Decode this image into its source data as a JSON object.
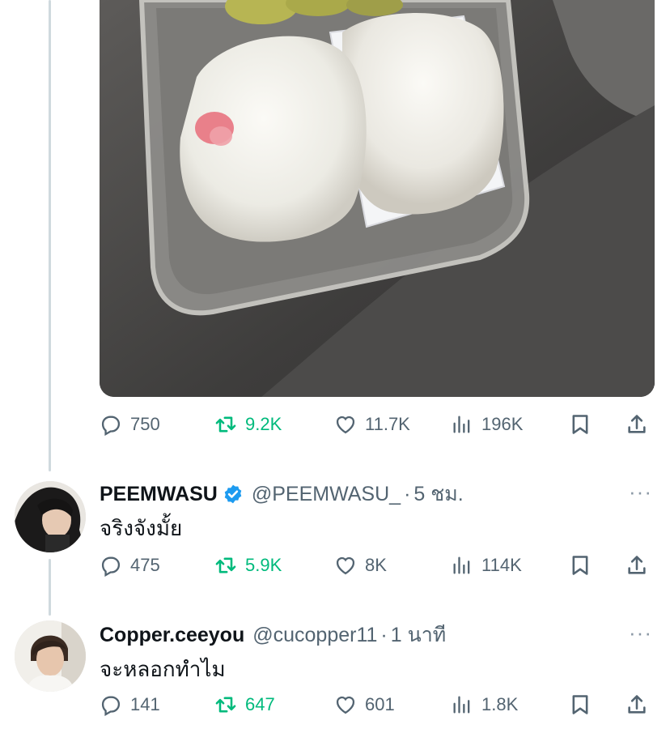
{
  "tweet1": {
    "stats": {
      "replies": "750",
      "retweets": "9.2K",
      "likes": "11.7K",
      "views": "196K"
    }
  },
  "tweet2": {
    "name": "PEEMWASU",
    "verified": true,
    "handle": "@PEEMWASU_",
    "separator": "·",
    "time": "5 ชม.",
    "text": "จริงจังมั้ย",
    "more": "···",
    "stats": {
      "replies": "475",
      "retweets": "5.9K",
      "likes": "8K",
      "views": "114K"
    }
  },
  "tweet3": {
    "name": "Copper.ceeyou",
    "verified": false,
    "handle": "@cucopper11",
    "separator": "·",
    "time": "1 นาที",
    "text": "จะหลอกทำไม",
    "more": "···",
    "stats": {
      "replies": "141",
      "retweets": "647",
      "likes": "601",
      "views": "1.8K"
    }
  },
  "colors": {
    "retweet": "#00ba7c",
    "muted": "#536471",
    "verified": "#1d9bf0",
    "thread_line": "#cfd9de"
  },
  "icons": [
    "reply-icon",
    "retweet-icon",
    "like-icon",
    "views-icon",
    "bookmark-icon",
    "share-icon",
    "verified-icon",
    "more-icon"
  ]
}
